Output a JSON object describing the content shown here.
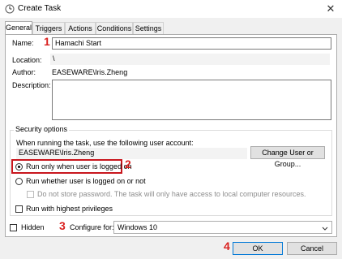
{
  "window": {
    "title": "Create Task",
    "close_glyph": "✕"
  },
  "tabs": [
    {
      "label": "General"
    },
    {
      "label": "Triggers"
    },
    {
      "label": "Actions"
    },
    {
      "label": "Conditions"
    },
    {
      "label": "Settings"
    }
  ],
  "general": {
    "name_label": "Name:",
    "name_value": "Hamachi Start",
    "location_label": "Location:",
    "location_value": "\\",
    "author_label": "Author:",
    "author_value": "EASEWARE\\Iris.Zheng",
    "description_label": "Description:",
    "description_value": ""
  },
  "security": {
    "group_title": "Security options",
    "account_prompt": "When running the task, use the following user account:",
    "account_value": "EASEWARE\\Iris.Zheng",
    "change_button": "Change User or Group...",
    "radio_logged_on": "Run only when user is logged on",
    "radio_logged_on_or_not": "Run whether user is logged on or not",
    "no_store_password": "Do not store password.  The task will only have access to local computer resources.",
    "highest_privileges": "Run with highest privileges"
  },
  "bottom": {
    "hidden_label": "Hidden",
    "configure_label": "Configure for:",
    "configure_value": "Windows 10",
    "ok_label": "OK",
    "cancel_label": "Cancel"
  },
  "markers": {
    "m1": "1",
    "m2": "2",
    "m3": "3",
    "m4": "4"
  },
  "colors": {
    "marker_red": "#d9201e",
    "accent_blue": "#0078d7"
  }
}
